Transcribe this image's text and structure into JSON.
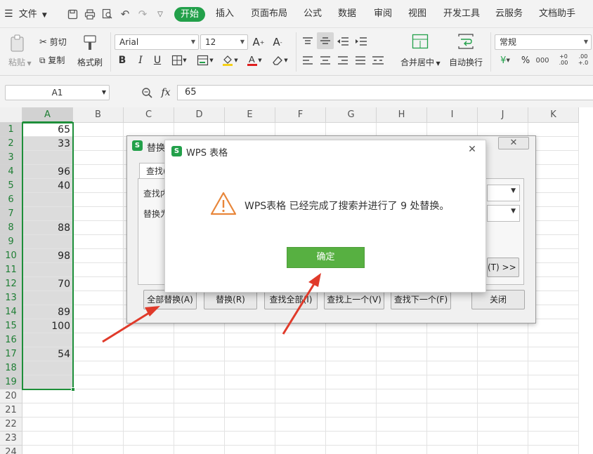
{
  "menubar": {
    "file_label": "文件",
    "tabs": [
      "开始",
      "插入",
      "页面布局",
      "公式",
      "数据",
      "审阅",
      "视图",
      "开发工具",
      "云服务",
      "文档助手"
    ]
  },
  "ribbon": {
    "paste": "粘贴",
    "cut": "剪切",
    "copy": "复制",
    "format_painter": "格式刷",
    "font_name": "Arial",
    "font_size": "12",
    "bold": "B",
    "italic": "I",
    "underline": "U",
    "merge_center": "合并居中",
    "wrap_text": "自动换行",
    "number_format": "常规"
  },
  "formula_bar": {
    "name_box": "A1",
    "fx": "fx",
    "value": "65"
  },
  "grid": {
    "columns": [
      "A",
      "B",
      "C",
      "D",
      "E",
      "F",
      "G",
      "H",
      "I",
      "J",
      "K"
    ],
    "rows": [
      "1",
      "2",
      "3",
      "4",
      "5",
      "6",
      "7",
      "8",
      "9",
      "10",
      "11",
      "12",
      "13",
      "14",
      "15",
      "16",
      "17",
      "18",
      "19",
      "20",
      "21",
      "22",
      "23",
      "24"
    ],
    "col_a_values": [
      "65",
      "33",
      "",
      "96",
      "40",
      "",
      "",
      "88",
      "",
      "98",
      "",
      "70",
      "",
      "89",
      "100",
      "",
      "54",
      "",
      ""
    ]
  },
  "replace_dialog": {
    "title": "替换",
    "tab_find": "查找(",
    "find_label": "查找内",
    "replace_label": "替换为",
    "options_button": "(T) >>",
    "buttons": {
      "replace_all": "全部替换(A)",
      "replace": "替换(R)",
      "find_all": "查找全部(I)",
      "find_prev": "查找上一个(V)",
      "find_next": "查找下一个(F)",
      "close": "关闭"
    }
  },
  "message_dialog": {
    "title": "WPS 表格",
    "text": "WPS表格 已经完成了搜索并进行了 9 处替换。",
    "ok": "确定"
  },
  "colors": {
    "accent": "#22a04a",
    "ok_button": "#57b041",
    "arrow": "#e03a2a",
    "selection_border": "#1e8f3a",
    "selection_fill": "#dcdcdc"
  }
}
